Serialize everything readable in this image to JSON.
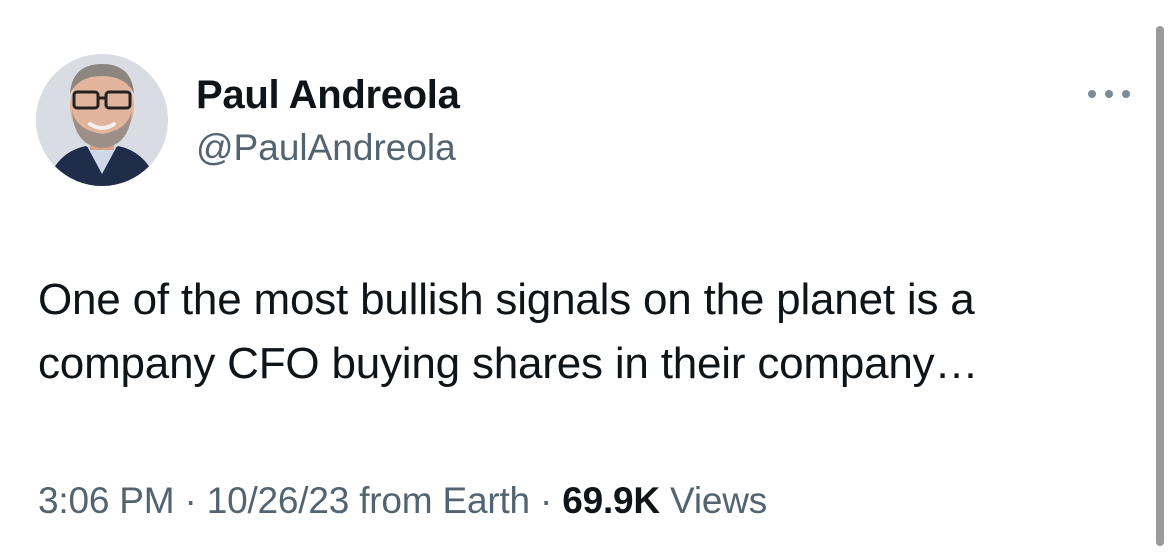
{
  "author": {
    "name": "Paul Andreola",
    "handle": "@PaulAndreola",
    "avatar_icon": "profile-photo"
  },
  "more_icon": "more-horizontal-icon",
  "tweet": {
    "lines": [
      "One of the most bullish signals on the planet is a",
      "company CFO buying shares in their company…"
    ]
  },
  "meta": {
    "time": "3:06 PM",
    "sep1": " · ",
    "date": "10/26/23",
    "source": " from Earth",
    "sep2": " · ",
    "views_count": "69.9K",
    "views_label": " Views"
  },
  "colors": {
    "text": "#0f1419",
    "secondary": "#536471",
    "background": "#ffffff"
  }
}
